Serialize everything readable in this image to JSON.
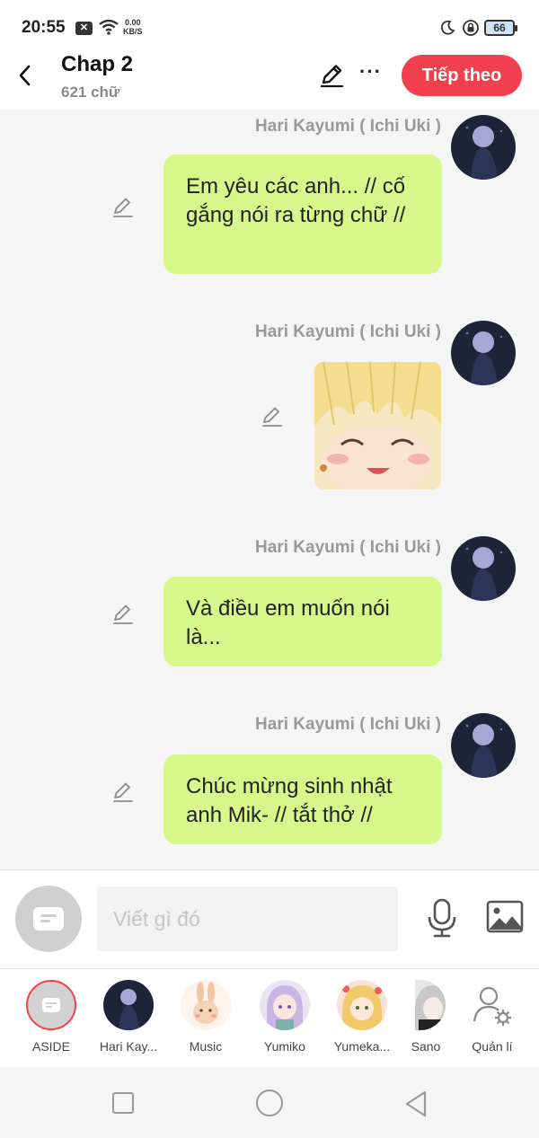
{
  "status_bar": {
    "time": "20:55",
    "speed_value": "0.00",
    "speed_unit": "KB/S",
    "battery": "66"
  },
  "header": {
    "title": "Chap 2",
    "word_count": "621 chữ",
    "next_label": "Tiếp theo"
  },
  "messages": [
    {
      "sender": "Hari Kayumi ( Ichi Uki )",
      "type": "text",
      "text": "Em yêu các anh... // cố gắng nói ra từng chữ //"
    },
    {
      "sender": "Hari Kayumi ( Ichi Uki )",
      "type": "image",
      "image": "anime-blonde-girl-laughing-sticker"
    },
    {
      "sender": "Hari Kayumi ( Ichi Uki )",
      "type": "text",
      "text": "Và điều em muốn nói là..."
    },
    {
      "sender": "Hari Kayumi ( Ichi Uki )",
      "type": "text",
      "text": "Chúc mừng sinh nhật anh Mik- // tắt thở //"
    }
  ],
  "composer": {
    "placeholder": "Viết gì đó",
    "icons": [
      "aside-card-icon",
      "microphone-icon",
      "image-icon"
    ]
  },
  "characters": [
    {
      "label": "ASIDE",
      "selected": true
    },
    {
      "label": "Hari Kay..."
    },
    {
      "label": "Music"
    },
    {
      "label": "Yumiko"
    },
    {
      "label": "Yumeka..."
    },
    {
      "label": "Sano"
    },
    {
      "label": "Quản lí"
    }
  ],
  "colors": {
    "accent": "#f2404f",
    "bubble": "#d8f78a"
  }
}
